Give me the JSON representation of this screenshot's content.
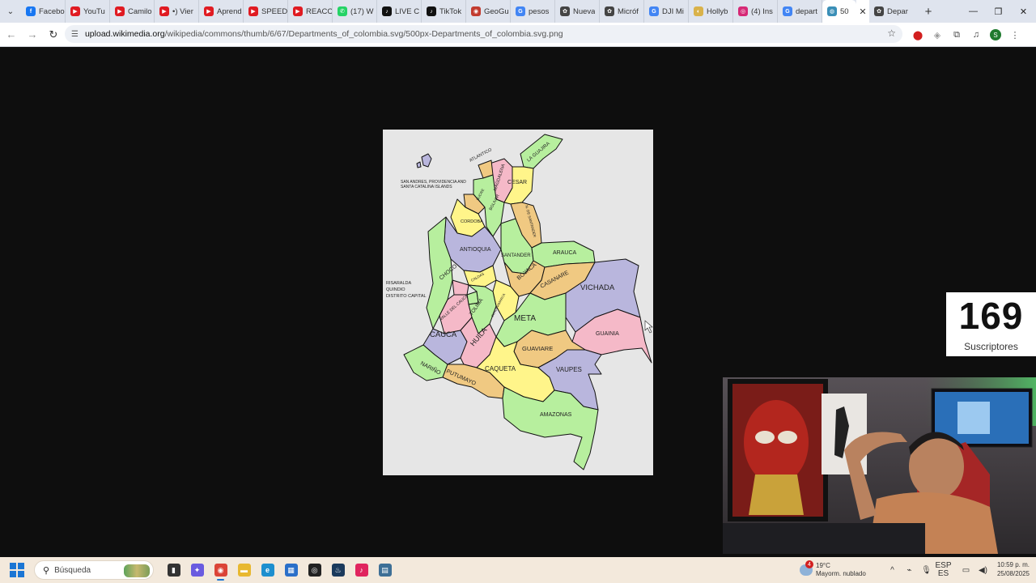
{
  "browser": {
    "tabs": [
      {
        "label": "Facebo",
        "color": "#1877f2",
        "glyph": "f"
      },
      {
        "label": "YouTu",
        "color": "#e01b22",
        "glyph": "▶"
      },
      {
        "label": "Camilo",
        "color": "#e01b22",
        "glyph": "▶"
      },
      {
        "label": "•) Vier",
        "color": "#e01b22",
        "glyph": "▶"
      },
      {
        "label": "Aprend",
        "color": "#e01b22",
        "glyph": "▶"
      },
      {
        "label": "SPEED",
        "color": "#e01b22",
        "glyph": "▶"
      },
      {
        "label": "REACC",
        "color": "#e01b22",
        "glyph": "▶"
      },
      {
        "label": "(17) W",
        "color": "#25d366",
        "glyph": "✆"
      },
      {
        "label": "LIVE C",
        "color": "#111111",
        "glyph": "♪"
      },
      {
        "label": "TikTok",
        "color": "#111111",
        "glyph": "♪"
      },
      {
        "label": "GeoGu",
        "color": "#c23b2f",
        "glyph": "◉"
      },
      {
        "label": "pesos",
        "color": "#4285f4",
        "glyph": "G"
      },
      {
        "label": "Nueva",
        "color": "#444444",
        "glyph": "✿"
      },
      {
        "label": "Micróf",
        "color": "#444444",
        "glyph": "✿"
      },
      {
        "label": "DJI Mi",
        "color": "#4285f4",
        "glyph": "G"
      },
      {
        "label": "Hollyb",
        "color": "#d9b24a",
        "glyph": "◐"
      },
      {
        "label": "(4) Ins",
        "color": "#d62976",
        "glyph": "◎"
      },
      {
        "label": "depart",
        "color": "#4285f4",
        "glyph": "G"
      }
    ],
    "active_tab": {
      "label": "50",
      "color": "#3a8fb7",
      "glyph": "◍"
    },
    "after_tab": {
      "label": "Depar",
      "color": "#444444",
      "glyph": "✿"
    },
    "url_domain": "upload.wikimedia.org",
    "url_path": "/wikipedia/commons/thumb/6/67/Departments_of_colombia.svg/500px-Departments_of_colombia.svg.png"
  },
  "map": {
    "labels": {
      "atlantico": "ATLANTICO",
      "la_guajira": "LA GUAJIRA",
      "magdalena": "MAGDALENA",
      "cesar": "CESAR",
      "san_andres_1": "SAN ANDRES, PROVIDENCIA AND",
      "san_andres_2": "SANTA CATALINA ISLANDS",
      "sucre": "SUCRE",
      "bolivar": "BOLIVAR",
      "norte_santander": "N. DE SANTANDER",
      "cordoba": "CORDOBA",
      "antioquia": "ANTIOQUIA",
      "santander": "SANTANDER",
      "arauca": "ARAUCA",
      "choco": "CHOCO",
      "caldas": "CALDAS",
      "boyaca": "BOYACA",
      "casanare": "CASANARE",
      "vichada": "VICHADA",
      "risaralda": "RISARALDA",
      "quindio": "QUINDIO",
      "distrito_capital": "DISTRITO CAPITAL",
      "cundinamarca": "CUNDINAMARCA",
      "valle": "VALLE DEL CAUCA",
      "tolima": "TOLIMA",
      "meta": "META",
      "cauca": "CAUCA",
      "huila": "HUILA",
      "guainia": "GUAINIA",
      "guaviare": "GUAVIARE",
      "narino": "NARIÑO",
      "putumayo": "PUTUMAYO",
      "caqueta": "CAQUETA",
      "vaupes": "VAUPES",
      "amazonas": "AMAZONAS"
    }
  },
  "overlay": {
    "subscribers_count": "169",
    "subscribers_label": "Suscriptores"
  },
  "taskbar": {
    "search_label": "Búsqueda",
    "apps": [
      {
        "name": "file-explorer-dark",
        "color": "#333333",
        "glyph": "▮"
      },
      {
        "name": "copilot",
        "color": "#6a5be0",
        "glyph": "✦"
      },
      {
        "name": "chrome",
        "color": "#db4437",
        "glyph": "◉"
      },
      {
        "name": "folder",
        "color": "#e8b830",
        "glyph": "▬"
      },
      {
        "name": "edge",
        "color": "#1d8fcf",
        "glyph": "e"
      },
      {
        "name": "store",
        "color": "#2a6fc9",
        "glyph": "▦"
      },
      {
        "name": "obs",
        "color": "#222222",
        "glyph": "◎"
      },
      {
        "name": "steam",
        "color": "#1b3a5c",
        "glyph": "♨"
      },
      {
        "name": "tiktok-app",
        "color": "#e0245e",
        "glyph": "♪"
      },
      {
        "name": "calculator",
        "color": "#3d6f96",
        "glyph": "▤"
      }
    ],
    "weather_badge": "4",
    "weather_temp": "19°C",
    "weather_desc": "Mayorm. nublado",
    "lang_top": "ESP",
    "lang_bottom": "ES",
    "time": "10:59 p. m.",
    "date": "25/08/2025"
  }
}
